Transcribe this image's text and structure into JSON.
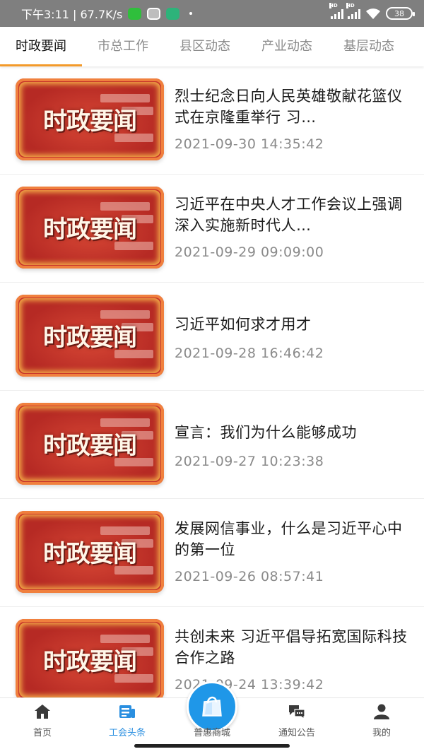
{
  "status_bar": {
    "time_speed": "下午3:11 | 67.7K/s",
    "battery": "38",
    "network_hd": "HD"
  },
  "tabs": [
    {
      "label": "时政要闻",
      "active": true
    },
    {
      "label": "市总工作",
      "active": false
    },
    {
      "label": "县区动态",
      "active": false
    },
    {
      "label": "产业动态",
      "active": false
    },
    {
      "label": "基层动态",
      "active": false
    }
  ],
  "thumbnail_text": "时政要闻",
  "news": [
    {
      "title": "烈士纪念日向人民英雄敬献花篮仪式在京隆重举行 习…",
      "time": "2021-09-30 14:35:42",
      "lines": 2
    },
    {
      "title": "习近平在中央人才工作会议上强调 深入实施新时代人…",
      "time": "2021-09-29 09:09:00",
      "lines": 2
    },
    {
      "title": "习近平如何求才用才",
      "time": "2021-09-28 16:46:42",
      "lines": 1
    },
    {
      "title": "宣言：我们为什么能够成功",
      "time": "2021-09-27 10:23:38",
      "lines": 1
    },
    {
      "title": "发展网信事业，什么是习近平心中的第一位",
      "time": "2021-09-26 08:57:41",
      "lines": 2
    },
    {
      "title": "共创未来 习近平倡导拓宽国际科技合作之路",
      "time": "2021-09-24 13:39:42",
      "lines": 2
    }
  ],
  "bottom_nav": [
    {
      "label": "首页",
      "icon": "home-icon",
      "active": false
    },
    {
      "label": "工会头条",
      "icon": "news-icon",
      "active": true
    },
    {
      "label": "普惠商城",
      "icon": "shopping-bag-icon",
      "active": false
    },
    {
      "label": "通知公告",
      "icon": "chat-bubbles-icon",
      "active": false
    },
    {
      "label": "我的",
      "icon": "user-icon",
      "active": false
    }
  ],
  "colors": {
    "tab_indicator": "#f39a2a",
    "nav_active": "#2a8fe0",
    "shop_button": "#1f97e8",
    "thumbnail_red": "#c7352b"
  }
}
